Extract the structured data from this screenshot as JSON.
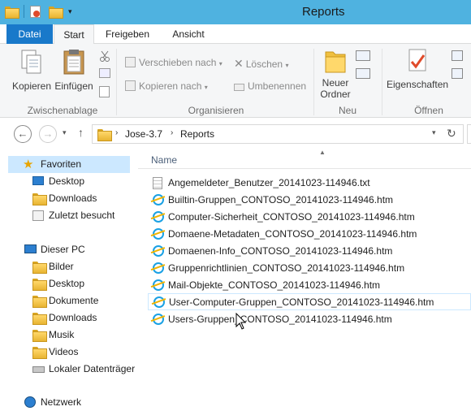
{
  "window": {
    "title": "Reports"
  },
  "ribbon_tabs": {
    "file": "Datei",
    "start": "Start",
    "share": "Freigeben",
    "view": "Ansicht"
  },
  "ribbon": {
    "copy": "Kopieren",
    "paste": "Einfügen",
    "clipboard_group": "Zwischenablage",
    "move_to": "Verschieben nach",
    "copy_to": "Kopieren nach",
    "delete": "Löschen",
    "rename": "Umbenennen",
    "organize_group": "Organisieren",
    "new_folder_line1": "Neuer",
    "new_folder_line2": "Ordner",
    "new_group": "Neu",
    "properties": "Eigenschaften",
    "open_group": "Öffnen"
  },
  "address": {
    "crumbs": [
      "Jose-3.7",
      "Reports"
    ]
  },
  "nav": {
    "favorites": "Favoriten",
    "fav_items": [
      "Desktop",
      "Downloads",
      "Zuletzt besucht"
    ],
    "this_pc": "Dieser PC",
    "pc_items": [
      "Bilder",
      "Desktop",
      "Dokumente",
      "Downloads",
      "Musik",
      "Videos",
      "Lokaler Datenträger"
    ],
    "network": "Netzwerk"
  },
  "filelist": {
    "column_name": "Name",
    "files": [
      {
        "name": "Angemeldeter_Benutzer_20141023-114946.txt",
        "icon": "text-file-icon"
      },
      {
        "name": "Builtin-Gruppen_CONTOSO_20141023-114946.htm",
        "icon": "ie-html-icon"
      },
      {
        "name": "Computer-Sicherheit_CONTOSO_20141023-114946.htm",
        "icon": "ie-html-icon"
      },
      {
        "name": "Domaene-Metadaten_CONTOSO_20141023-114946.htm",
        "icon": "ie-html-icon"
      },
      {
        "name": "Domaenen-Info_CONTOSO_20141023-114946.htm",
        "icon": "ie-html-icon"
      },
      {
        "name": "Gruppenrichtlinien_CONTOSO_20141023-114946.htm",
        "icon": "ie-html-icon"
      },
      {
        "name": "Mail-Objekte_CONTOSO_20141023-114946.htm",
        "icon": "ie-html-icon"
      },
      {
        "name": "User-Computer-Gruppen_CONTOSO_20141023-114946.htm",
        "icon": "ie-html-icon"
      },
      {
        "name": "Users-Gruppen_CONTOSO_20141023-114946.htm",
        "icon": "ie-html-icon"
      }
    ]
  },
  "colors": {
    "titlebar": "#4fb2e0",
    "file_tab": "#1979ca",
    "nav_selected": "#cce8ff"
  }
}
